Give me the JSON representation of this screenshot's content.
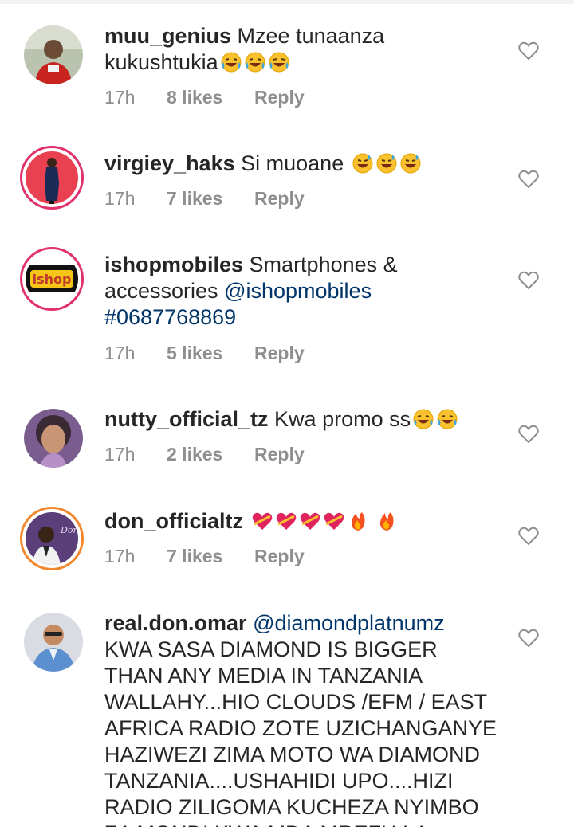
{
  "comments": [
    {
      "username": "muu_genius",
      "text_parts": [
        "Mzee tunaanza kukushtukia"
      ],
      "emoji": [
        "laughing-tears",
        "laughing-tears",
        "laughing-tears"
      ],
      "time": "17h",
      "likes": "8 likes",
      "reply": "Reply"
    },
    {
      "username": "virgiey_haks",
      "text_parts": [
        "Si muoane"
      ],
      "emoji": [
        "sweat-smile",
        "sweat-smile",
        "sweat-smile"
      ],
      "time": "17h",
      "likes": "7 likes",
      "reply": "Reply"
    },
    {
      "username": "ishopmobiles",
      "text": "Smartphones & accessories",
      "mention1": "@ishopmobiles",
      "mention2": "#0687768869",
      "logo_text": "ishop",
      "time": "17h",
      "likes": "5 likes",
      "reply": "Reply"
    },
    {
      "username": "nutty_official_tz",
      "text_parts": [
        "Kwa promo ss"
      ],
      "emoji": [
        "laughing-tears",
        "laughing-tears"
      ],
      "time": "17h",
      "likes": "2 likes",
      "reply": "Reply"
    },
    {
      "username": "don_officialtz",
      "emoji": [
        "heart-with-ribbon",
        "heart-with-ribbon",
        "heart-with-ribbon",
        "heart-with-ribbon",
        "fire",
        "fire"
      ],
      "avatar_text": "Don",
      "time": "17h",
      "likes": "7 likes",
      "reply": "Reply"
    },
    {
      "username": "real.don.omar",
      "mention": "@diamondplatnumz",
      "text_lines": [
        "KWA SASA DIAMOND IS BIGGER",
        "THAN ANY MEDIA IN TANZANIA",
        "WALLAHY...HIO CLOUDS /EFM / EAST",
        "AFRICA RADIO ZOTE UZICHANGANYE",
        "HAZIWEZI ZIMA MOTO WA DIAMOND",
        "TANZANIA....USHAHIDI UPO....HIZI",
        "RADIO ZILIGOMA KUCHEZA NYIMBO",
        "ZA MONDI KWA MDA MREFU LA"
      ]
    }
  ],
  "colors": {
    "text": "#262626",
    "meta": "#8e8e8e",
    "mention": "#003569",
    "story_ring": "#e1306c"
  },
  "icons": {
    "like": "heart-outline-icon"
  }
}
